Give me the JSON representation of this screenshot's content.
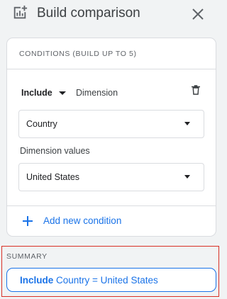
{
  "header": {
    "title": "Build comparison",
    "icon": "compare-chart-icon",
    "close_icon": "close-icon"
  },
  "conditions": {
    "label": "CONDITIONS (BUILD UP TO 5)",
    "include_label": "Include",
    "dimension_label": "Dimension",
    "dimension_value": "Country",
    "dimension_values_label": "Dimension values",
    "values_value": "United States",
    "delete_icon": "trash-icon",
    "add_label": "Add new condition"
  },
  "summary": {
    "label": "SUMMARY",
    "include_word": "Include",
    "expression": " Country = United States"
  },
  "colors": {
    "accent": "#1a73e8",
    "highlight_border": "#d93025",
    "background": "#f1f3f4"
  }
}
